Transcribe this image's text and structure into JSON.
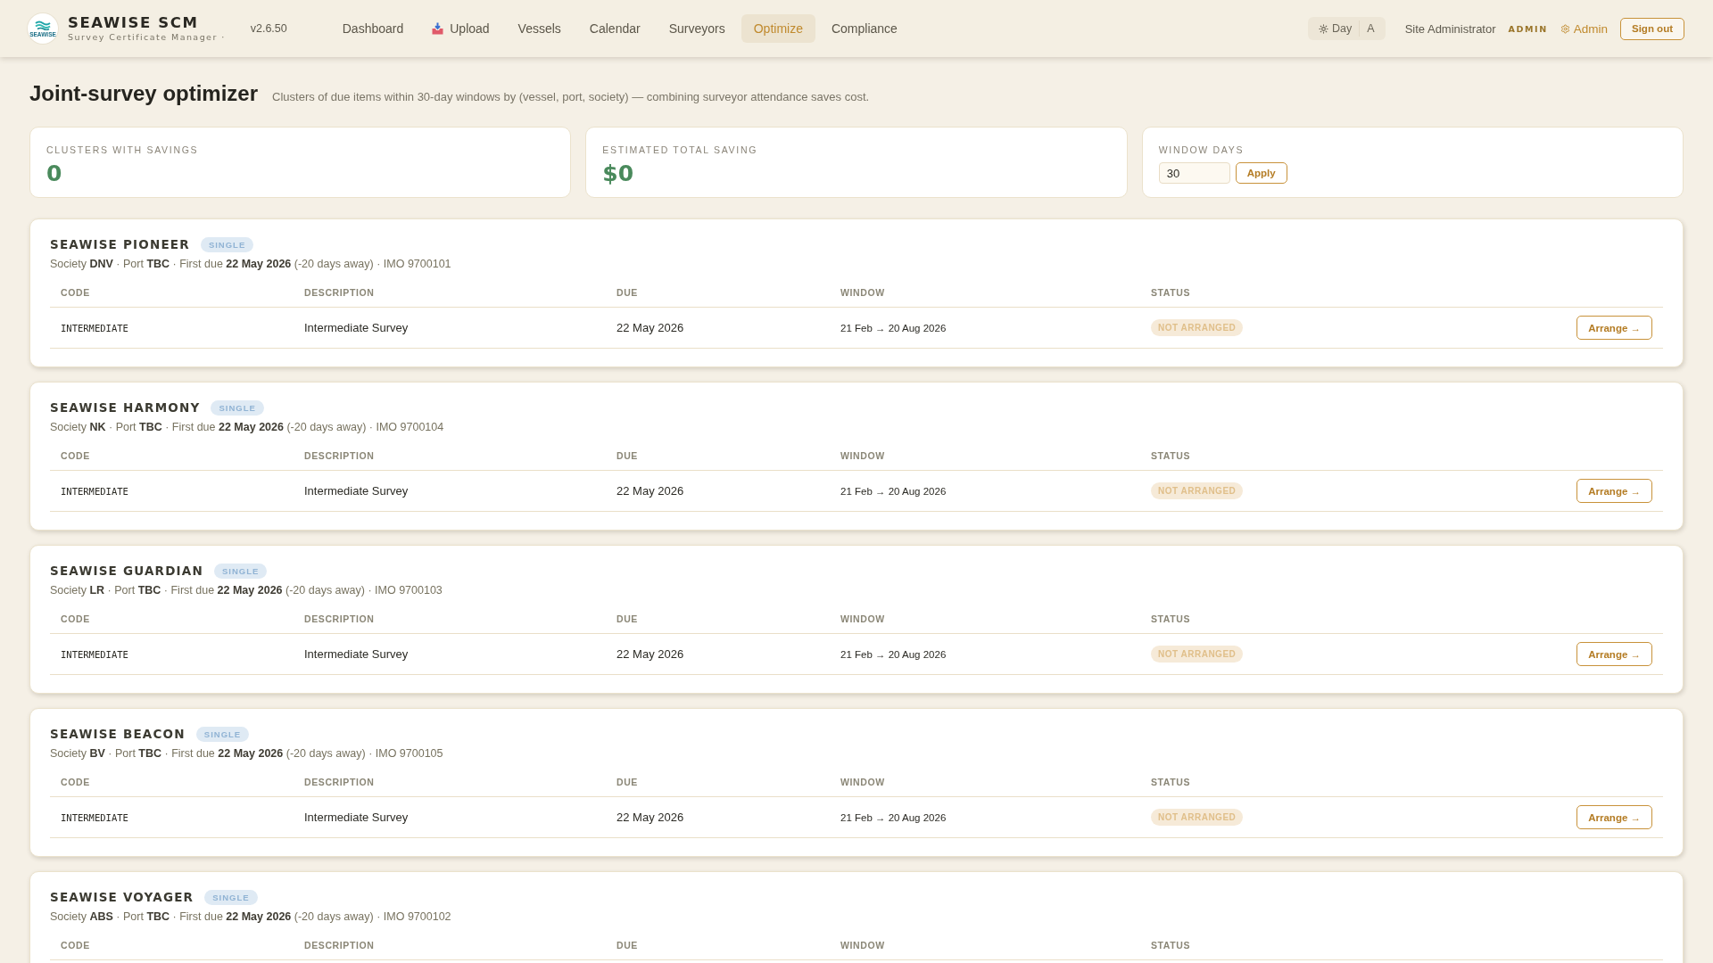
{
  "header": {
    "logo_text": "SEAWISE",
    "brand": "SEAWISE SCM",
    "tagline": "Survey Certificate Manager ·",
    "version": "v2.6.50",
    "nav": [
      {
        "label": "Dashboard",
        "kind": "text",
        "selected": false
      },
      {
        "label": "Upload",
        "kind": "icon",
        "selected": false
      },
      {
        "label": "Vessels",
        "kind": "text",
        "selected": false
      },
      {
        "label": "Calendar",
        "kind": "text",
        "selected": false
      },
      {
        "label": "Surveyors",
        "kind": "text",
        "selected": false
      },
      {
        "label": "Optimize",
        "kind": "text",
        "selected": true
      },
      {
        "label": "Compliance",
        "kind": "text",
        "selected": false
      }
    ],
    "theme_toggle": [
      {
        "label": "Day",
        "kind": "icon"
      },
      {
        "label": "A",
        "kind": "text"
      }
    ],
    "user": "Site Administrator",
    "role": "ADMIN",
    "admin_link": "Admin",
    "sign_out": "Sign out"
  },
  "page": {
    "title": "Joint-survey optimizer",
    "subtitle": "Clusters of due items within 30-day windows by (vessel, port, society) — combining surveyor attendance saves cost."
  },
  "stats": [
    {
      "kind": "value",
      "label": "CLUSTERS WITH SAVINGS",
      "value": "0"
    },
    {
      "kind": "value",
      "label": "ESTIMATED TOTAL SAVING",
      "value": "$0"
    },
    {
      "kind": "input",
      "label": "WINDOW DAYS",
      "value": "30",
      "button": "Apply"
    }
  ],
  "clusters": [
    {
      "vessel": "SEAWISE PIONEER",
      "tag": "SINGLE",
      "meta": "Society **DNV** · Port **TBC** · First due **22 May 2026** (-20 days away) · IMO 9700101",
      "columns": [
        "CODE",
        "DESCRIPTION",
        "DUE",
        "WINDOW",
        "STATUS"
      ],
      "items": [
        {
          "code": "INTERMEDIATE",
          "description": "Intermediate Survey",
          "due": "22 May 2026",
          "window": "21 Feb → 20 Aug 2026",
          "status": "NOT ARRANGED",
          "action": "Arrange →"
        }
      ]
    },
    {
      "vessel": "SEAWISE HARMONY",
      "tag": "SINGLE",
      "meta": "Society **NK** · Port **TBC** · First due **22 May 2026** (-20 days away) · IMO 9700104",
      "columns": [
        "CODE",
        "DESCRIPTION",
        "DUE",
        "WINDOW",
        "STATUS"
      ],
      "items": [
        {
          "code": "INTERMEDIATE",
          "description": "Intermediate Survey",
          "due": "22 May 2026",
          "window": "21 Feb → 20 Aug 2026",
          "status": "NOT ARRANGED",
          "action": "Arrange →"
        }
      ]
    },
    {
      "vessel": "SEAWISE GUARDIAN",
      "tag": "SINGLE",
      "meta": "Society **LR** · Port **TBC** · First due **22 May 2026** (-20 days away) · IMO 9700103",
      "columns": [
        "CODE",
        "DESCRIPTION",
        "DUE",
        "WINDOW",
        "STATUS"
      ],
      "items": [
        {
          "code": "INTERMEDIATE",
          "description": "Intermediate Survey",
          "due": "22 May 2026",
          "window": "21 Feb → 20 Aug 2026",
          "status": "NOT ARRANGED",
          "action": "Arrange →"
        }
      ]
    },
    {
      "vessel": "SEAWISE BEACON",
      "tag": "SINGLE",
      "meta": "Society **BV** · Port **TBC** · First due **22 May 2026** (-20 days away) · IMO 9700105",
      "columns": [
        "CODE",
        "DESCRIPTION",
        "DUE",
        "WINDOW",
        "STATUS"
      ],
      "items": [
        {
          "code": "INTERMEDIATE",
          "description": "Intermediate Survey",
          "due": "22 May 2026",
          "window": "21 Feb → 20 Aug 2026",
          "status": "NOT ARRANGED",
          "action": "Arrange →"
        }
      ]
    },
    {
      "vessel": "SEAWISE VOYAGER",
      "tag": "SINGLE",
      "meta": "Society **ABS** · Port **TBC** · First due **22 May 2026** (-20 days away) · IMO 9700102",
      "columns": [
        "CODE",
        "DESCRIPTION",
        "DUE",
        "WINDOW",
        "STATUS"
      ]
    }
  ]
}
